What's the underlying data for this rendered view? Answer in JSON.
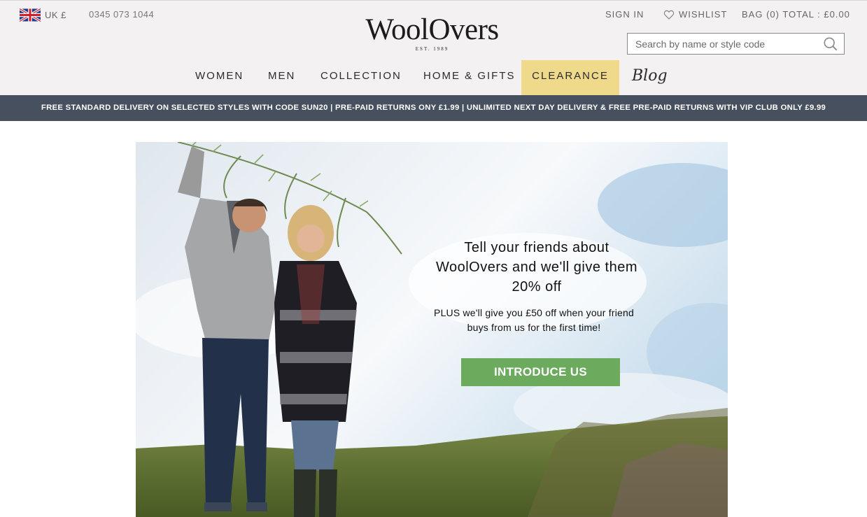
{
  "header": {
    "locale": "UK £",
    "phone": "0345 073 1044",
    "logo_word": "WoolOvers",
    "logo_est": "EST. 1989",
    "sign_in": "SIGN IN",
    "wishlist": "WISHLIST",
    "bag": "BAG (0) TOTAL : £0.00",
    "search_placeholder": "Search by name or style code"
  },
  "nav": {
    "items": [
      "WOMEN",
      "MEN",
      "COLLECTION",
      "HOME & GIFTS",
      "CLEARANCE"
    ],
    "blog": "Blog",
    "clearance_color": "#efd98b"
  },
  "promo_bar": {
    "text": "FREE STANDARD DELIVERY ON SELECTED STYLES WITH CODE SUN20 | PRE-PAID RETURNS ONY £1.99 | UNLIMITED NEXT DAY DELIVERY & FREE PRE-PAID RETURNS WITH VIP CLUB ONLY £9.99",
    "background": "#46505e"
  },
  "hero": {
    "heading": "Tell your friends about WoolOvers and we'll give them 20% off",
    "subtext": "PLUS we'll give you £50 off when your friend buys from us for the first time!",
    "cta": "INTRODUCE US",
    "cta_color": "#6cab5d"
  }
}
